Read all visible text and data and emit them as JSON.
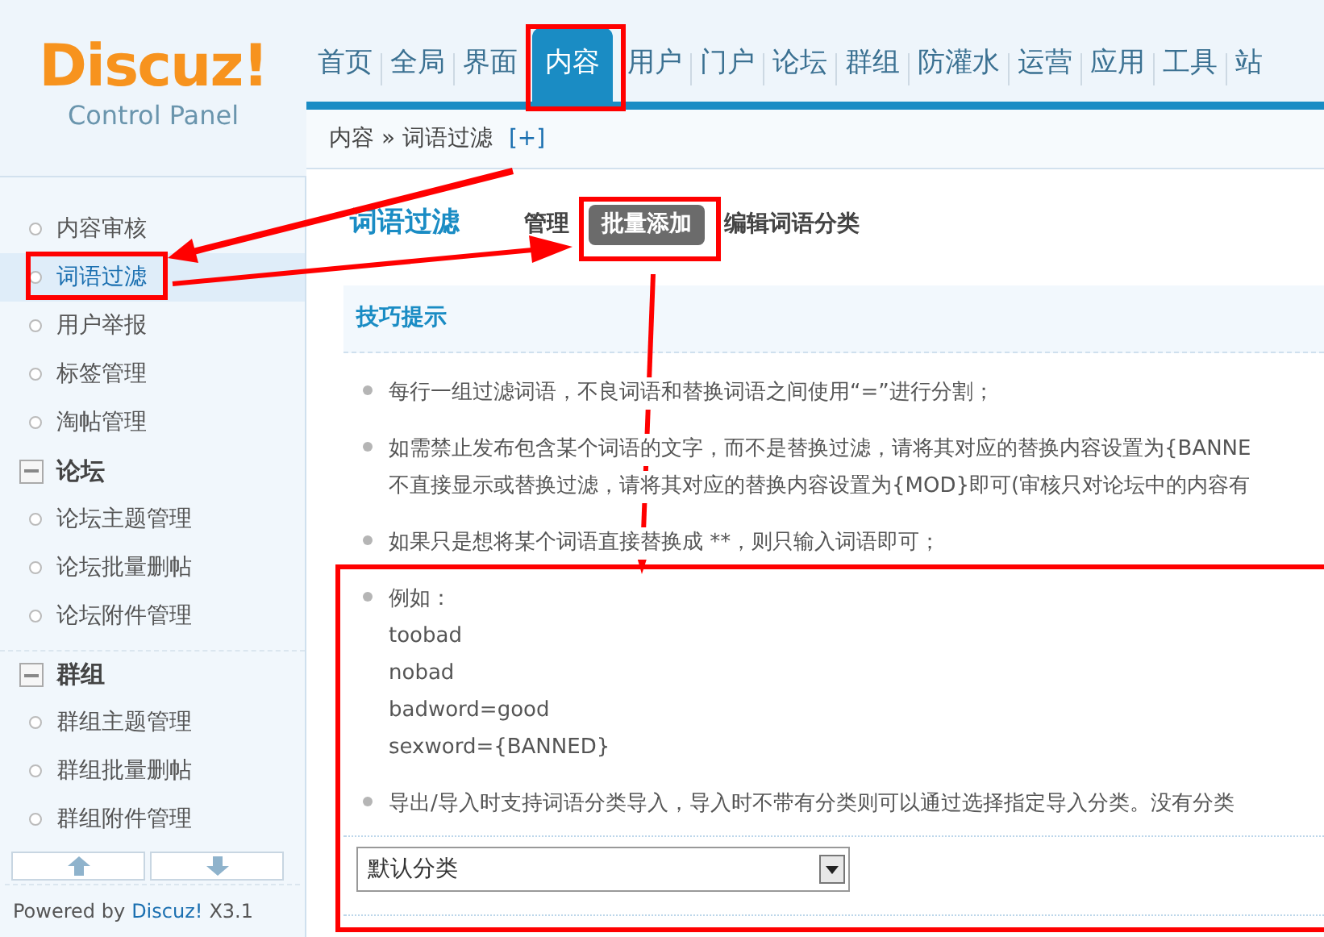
{
  "logo": {
    "title": "Discuz!",
    "subtitle": "Control Panel"
  },
  "nav": [
    {
      "label": "首页",
      "selected": false
    },
    {
      "label": "全局",
      "selected": false
    },
    {
      "label": "界面",
      "selected": false
    },
    {
      "label": "内容",
      "selected": true
    },
    {
      "label": "用户",
      "selected": false
    },
    {
      "label": "门户",
      "selected": false
    },
    {
      "label": "论坛",
      "selected": false
    },
    {
      "label": "群组",
      "selected": false
    },
    {
      "label": "防灌水",
      "selected": false
    },
    {
      "label": "运营",
      "selected": false
    },
    {
      "label": "应用",
      "selected": false
    },
    {
      "label": "工具",
      "selected": false
    },
    {
      "label": "站",
      "selected": false
    }
  ],
  "breadcrumb": {
    "text": "内容 » 词语过滤",
    "link": "[+]"
  },
  "sidebar": {
    "items": [
      {
        "kind": "item",
        "label": "内容审核",
        "selected": false
      },
      {
        "kind": "item",
        "label": "词语过滤",
        "selected": true
      },
      {
        "kind": "item",
        "label": "用户举报",
        "selected": false
      },
      {
        "kind": "item",
        "label": "标签管理",
        "selected": false
      },
      {
        "kind": "item",
        "label": "淘帖管理",
        "selected": false
      },
      {
        "kind": "group",
        "label": "论坛",
        "selected": false
      },
      {
        "kind": "item",
        "label": "论坛主题管理",
        "selected": false
      },
      {
        "kind": "item",
        "label": "论坛批量删帖",
        "selected": false
      },
      {
        "kind": "item",
        "label": "论坛附件管理",
        "selected": false
      },
      {
        "kind": "group",
        "label": "群组",
        "selected": false
      },
      {
        "kind": "item",
        "label": "群组主题管理",
        "selected": false
      },
      {
        "kind": "item",
        "label": "群组批量删帖",
        "selected": false
      },
      {
        "kind": "item",
        "label": "群组附件管理",
        "selected": false
      }
    ],
    "footer": {
      "prefix": "Powered by",
      "brand": "Discuz!",
      "version": "X3.1"
    }
  },
  "page": {
    "title": "词语过滤",
    "tabs": [
      {
        "label": "管理",
        "selected": false
      },
      {
        "label": "批量添加",
        "selected": true
      },
      {
        "label": "编辑词语分类",
        "selected": false
      }
    ],
    "tips": {
      "title": "技巧提示",
      "items": [
        {
          "lines": [
            "每行一组过滤词语，不良词语和替换词语之间使用“=”进行分割；"
          ]
        },
        {
          "lines": [
            "如需禁止发布包含某个词语的文字，而不是替换过滤，请将其对应的替换内容设置为{BANNE",
            "不直接显示或替换过滤，请将其对应的替换内容设置为{MOD}即可(审核只对论坛中的内容有"
          ]
        },
        {
          "lines": [
            "如果只是想将某个词语直接替换成 **，则只输入词语即可；"
          ]
        },
        {
          "lines": [
            "例如：",
            "toobad",
            "nobad",
            "badword=good",
            "sexword={BANNED}"
          ]
        },
        {
          "lines": [
            "导出/导入时支持词语分类导入，导入时不带有分类则可以通过选择指定导入分类。没有分类"
          ]
        }
      ]
    },
    "category_select": {
      "value": "默认分类"
    }
  }
}
